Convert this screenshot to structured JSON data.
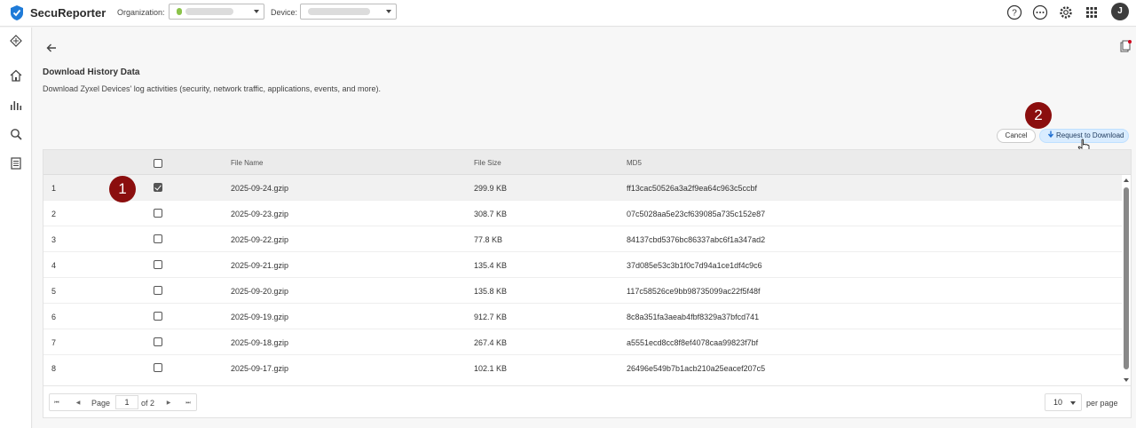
{
  "app": {
    "name": "SecuReporter",
    "user_initial": "J"
  },
  "topbar": {
    "org_label": "Organization:",
    "device_label": "Device:",
    "icons": [
      "help-icon",
      "more-icon",
      "gear-icon",
      "apps-grid-icon"
    ]
  },
  "sidebar": {
    "icons": [
      "network-icon",
      "home-icon",
      "analytics-icon",
      "search-icon",
      "report-icon"
    ]
  },
  "page": {
    "title": "Download History Data",
    "subtitle": "Download Zyxel Devices' log activities (security, network traffic, applications, events, and more)."
  },
  "actions": {
    "cancel": "Cancel",
    "request": "Request to Download"
  },
  "steps": {
    "one": "1",
    "two": "2"
  },
  "table": {
    "headers": {
      "index": "",
      "file_name": "File Name",
      "file_size": "File Size",
      "md5": "MD5"
    },
    "rows": [
      {
        "n": "1",
        "checked": true,
        "file": "2025-09-24.gzip",
        "size": "299.9 KB",
        "md5": "ff13cac50526a3a2f9ea64c963c5ccbf"
      },
      {
        "n": "2",
        "checked": false,
        "file": "2025-09-23.gzip",
        "size": "308.7 KB",
        "md5": "07c5028aa5e23cf639085a735c152e87"
      },
      {
        "n": "3",
        "checked": false,
        "file": "2025-09-22.gzip",
        "size": "77.8 KB",
        "md5": "84137cbd5376bc86337abc6f1a347ad2"
      },
      {
        "n": "4",
        "checked": false,
        "file": "2025-09-21.gzip",
        "size": "135.4 KB",
        "md5": "37d085e53c3b1f0c7d94a1ce1df4c9c6"
      },
      {
        "n": "5",
        "checked": false,
        "file": "2025-09-20.gzip",
        "size": "135.8 KB",
        "md5": "117c58526ce9bb98735099ac22f5f48f"
      },
      {
        "n": "6",
        "checked": false,
        "file": "2025-09-19.gzip",
        "size": "912.7 KB",
        "md5": "8c8a351fa3aeab4fbf8329a37bfcd741"
      },
      {
        "n": "7",
        "checked": false,
        "file": "2025-09-18.gzip",
        "size": "267.4 KB",
        "md5": "a5551ecd8cc8f8ef4078caa99823f7bf"
      },
      {
        "n": "8",
        "checked": false,
        "file": "2025-09-17.gzip",
        "size": "102.1 KB",
        "md5": "26496e549b7b1acb210a25eacef207c5"
      }
    ]
  },
  "pagination": {
    "page_label": "Page",
    "page": "1",
    "of_label": "of 2",
    "per_page": "10",
    "per_page_label": "per page"
  },
  "colors": {
    "step_badge": "#8b0e0e",
    "request_button": "#d9ecff"
  }
}
